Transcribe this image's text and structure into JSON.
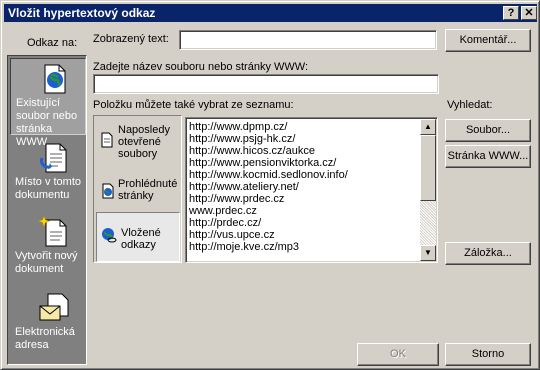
{
  "window": {
    "title": "Vložit hypertextový odkaz",
    "help_label": "?",
    "close_label": "✕"
  },
  "nav": {
    "heading": "Odkaz na:",
    "items": [
      {
        "line1": "Existující",
        "line2": "soubor nebo",
        "line3": "stránka WWW",
        "icon": "web-page-icon"
      },
      {
        "line1": "Místo v tomto",
        "line2": "dokumentu",
        "line3": "",
        "icon": "document-place-icon"
      },
      {
        "line1": "Vytvořit nový",
        "line2": "dokument",
        "line3": "",
        "icon": "new-document-icon"
      },
      {
        "line1": "Elektronická",
        "line2": "adresa",
        "line3": "",
        "icon": "email-icon"
      }
    ]
  },
  "display_text": {
    "label": "Zobrazený text:",
    "value": ""
  },
  "comment_button": "Komentář...",
  "address": {
    "label": "Zadejte název souboru nebo stránky WWW:",
    "value": ""
  },
  "list_label": "Položku můžete také vybrat ze seznamu:",
  "categories": [
    {
      "line1": "Naposledy",
      "line2": "otevřené",
      "line3": "soubory"
    },
    {
      "line1": "Prohlédnuté",
      "line2": "stránky",
      "line3": ""
    },
    {
      "line1": "Vložené",
      "line2": "odkazy",
      "line3": ""
    }
  ],
  "urls": [
    "http://www.dpmp.cz/",
    "http://www.psjg-hk.cz/",
    "http://www.hicos.cz/aukce",
    "http://www.pensionviktorka.cz/",
    "http://www.kocmid.sedlonov.info/",
    "http://www.ateliery.net/",
    "http://www.prdec.cz",
    "www.prdec.cz",
    "http://prdec.cz/",
    "http://vus.upce.cz",
    "http://moje.kve.cz/mp3"
  ],
  "search": {
    "label": "Vyhledat:",
    "file_button": "Soubor...",
    "web_button": "Stránka WWW..."
  },
  "bookmark_button": "Záložka...",
  "ok_button": "OK",
  "cancel_button": "Storno",
  "colors": {
    "titlebar": "#0a246a",
    "face": "#d4d0c8",
    "nav_bg": "#808080"
  }
}
